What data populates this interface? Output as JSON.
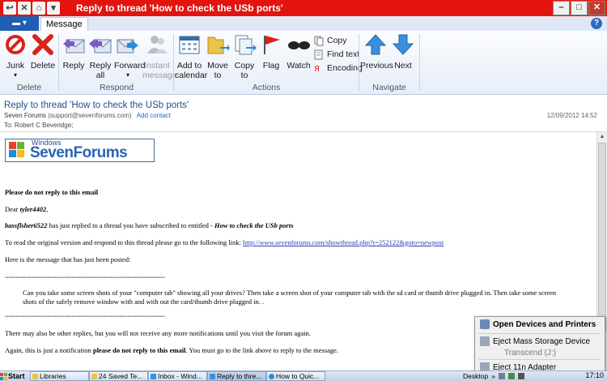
{
  "window": {
    "title": "Reply to thread 'How to check the USb ports'",
    "buttons": {
      "minimize": "–",
      "maximize": "□",
      "close": "✕"
    }
  },
  "ribbon": {
    "app_menu_label": "▾",
    "tab": "Message",
    "groups": {
      "delete": {
        "label": "Delete",
        "junk": "Junk",
        "junk_arrow": "▾",
        "delete": "Delete"
      },
      "respond": {
        "label": "Respond",
        "reply": "Reply",
        "reply_all_1": "Reply",
        "reply_all_2": "all",
        "forward": "Forward",
        "forward_arrow": "▾",
        "instant_1": "Instant",
        "instant_2": "message"
      },
      "actions": {
        "label": "Actions",
        "calendar_1": "Add to",
        "calendar_2": "calendar",
        "move_1": "Move",
        "move_2": "to",
        "copyto_1": "Copy",
        "copyto_2": "to",
        "flag": "Flag",
        "watch": "Watch",
        "copy": "Copy",
        "find_text": "Find text",
        "encoding": "Encoding"
      },
      "navigate": {
        "label": "Navigate",
        "previous": "Previous",
        "next": "Next"
      }
    }
  },
  "message": {
    "subject": "Reply to thread 'How to check the USb ports'",
    "from_name": "Seven Forums",
    "from_email": "(support@sevenforums.com)",
    "add_contact": "Add contact",
    "date": "12/09/2012 14:52",
    "to": "To: Robert C Beveridge;",
    "logo_top": "Windows",
    "logo_main": "SevenForums",
    "body": {
      "warning": "Please do not reply to this email",
      "greeting_pre": "Dear ",
      "greeting_name": "tyler4402",
      "greeting_post": ",",
      "replied_user": "bassflsher6522",
      "replied_mid": " has just replied to a thread you have subscribed to entitled - ",
      "thread_title": "How to check the USb ports",
      "read_text": "To read the original version and respond to this thread please go to the following link: ",
      "link": "http://www.sevenforums.com/showthread.php?t=252122&goto=newpost",
      "posted_intro": "Here is the message that has just been posted:",
      "divider": "~~~~~~~~~~~~~~~~~~~~~~~~~~~~~~~~~~~~~~~~~~~",
      "post_line1": "Can you take some screen shots of your \"computer tab\" showing all your drives? Then take a screen shot of your computer tab with the sd card or thumb drive plugged in. Then take some screen",
      "post_line2": "shots of the safely remove window with and with out the card/thumb drive plugged in. .",
      "more_replies": "There may also be other replies, but you will not receive any more notifications until you visit the forum again.",
      "notif_pre": "Again, this is just a notification ",
      "notif_bold": "please do not reply to this email",
      "notif_post": ". You must go to the link above to reply to the message."
    }
  },
  "popup_menu": {
    "open_devices": "Open Devices and Printers",
    "eject_mass": "Eject Mass Storage Device",
    "transcend": "Transcend (J:)",
    "eject_11n": "Eject 11n Adapter"
  },
  "taskbar": {
    "start": "Start",
    "items": [
      "Libraries",
      "24 Saved Te...",
      "Inbox - Wind...",
      "Reply to thre...",
      "How to Quic..."
    ],
    "desktop": "Desktop",
    "clock": "17:10"
  },
  "colors": {
    "title_bar": "#e3140f",
    "accent_blue": "#1f5fb3",
    "link": "#2a3fb0"
  }
}
